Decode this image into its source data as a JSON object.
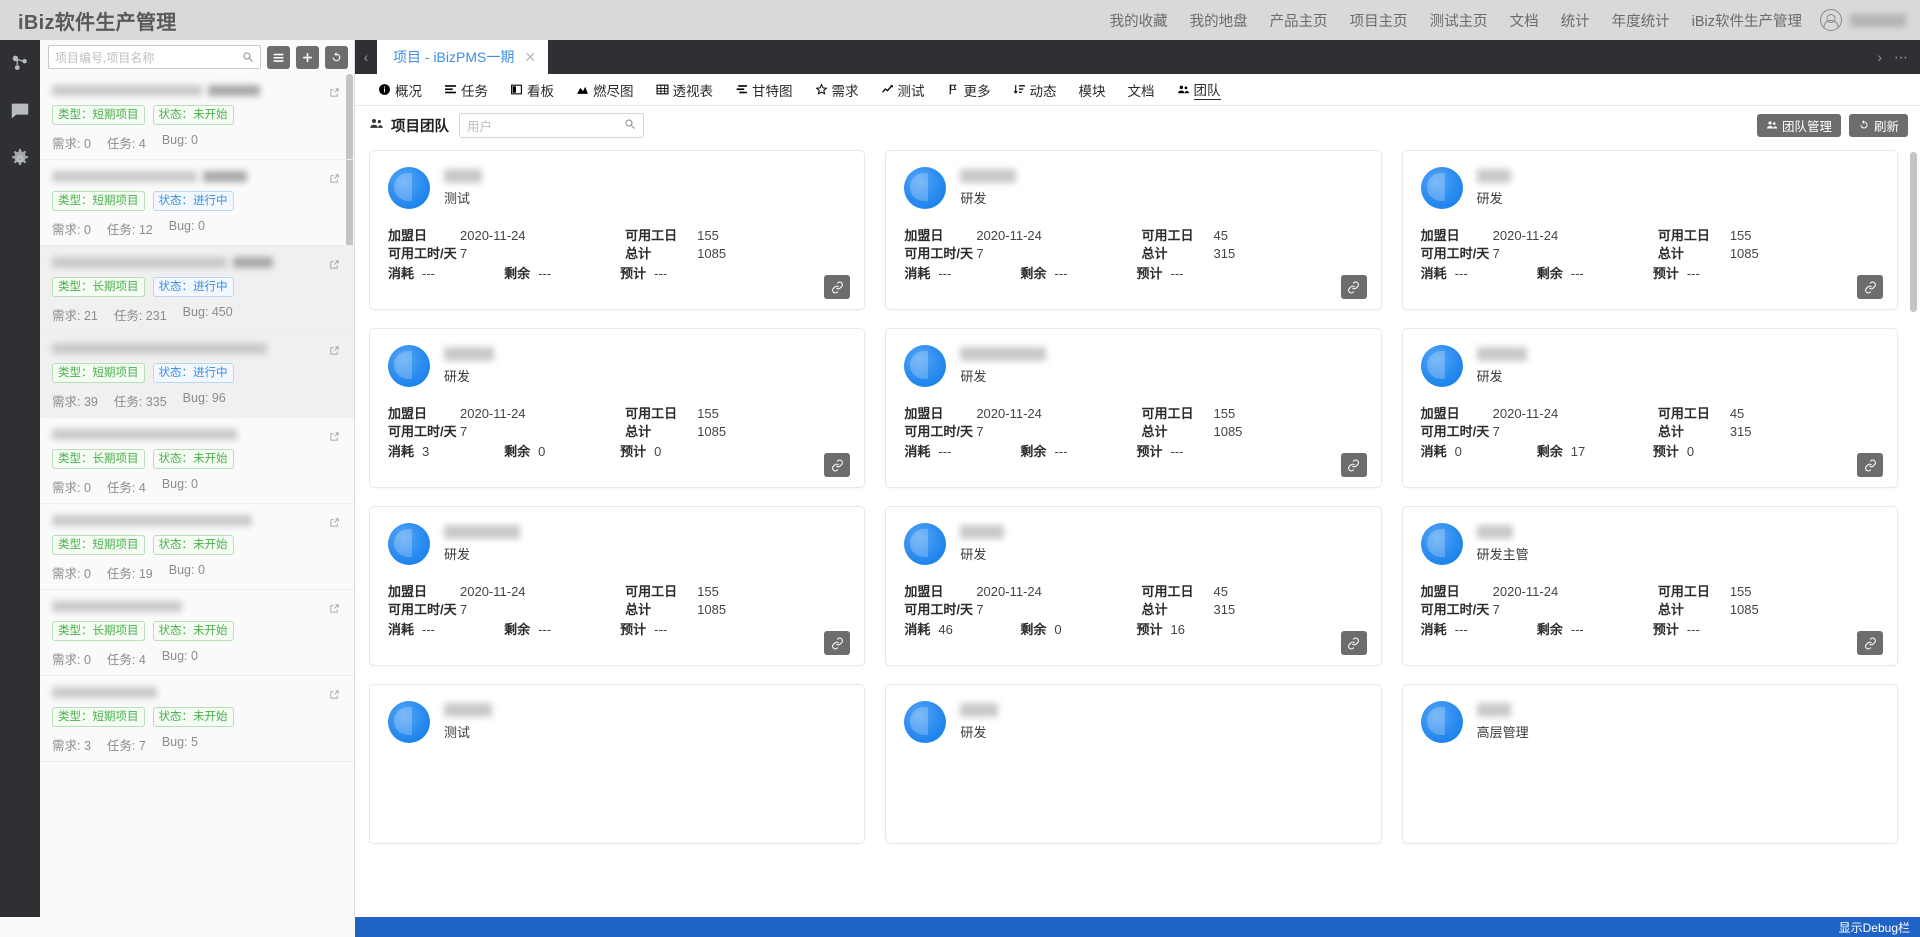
{
  "header": {
    "title": "iBiz软件生产管理",
    "nav": [
      "我的收藏",
      "我的地盘",
      "产品主页",
      "项目主页",
      "测试主页",
      "文档",
      "统计",
      "年度统计",
      "iBiz软件生产管理"
    ],
    "user_avatar_icon": "user-circle-icon"
  },
  "rail": {
    "items": [
      {
        "name": "org-icon",
        "label": "组织"
      },
      {
        "name": "message-icon",
        "label": "消息"
      },
      {
        "name": "gear-icon",
        "label": "设置"
      }
    ]
  },
  "sidebar": {
    "search_placeholder": "项目编号,项目名称",
    "search_icon": "search-icon",
    "buttons": [
      {
        "name": "list-view-button",
        "icon": "list-icon"
      },
      {
        "name": "add-project-button",
        "icon": "plus-icon"
      },
      {
        "name": "refresh-projects-button",
        "icon": "refresh-icon"
      }
    ],
    "items": [
      {
        "type_label": "类型：短期项目",
        "status_label": "状态：未开始",
        "status_kind": "green",
        "stats": [
          "需求: 0",
          "任务: 4",
          "Bug: 0"
        ],
        "selected": false,
        "name_w": 150,
        "tail_w": 52
      },
      {
        "type_label": "类型：短期项目",
        "status_label": "状态：进行中",
        "status_kind": "blue",
        "stats": [
          "需求: 0",
          "任务: 12",
          "Bug: 0"
        ],
        "selected": false,
        "name_w": 145,
        "tail_w": 44
      },
      {
        "type_label": "类型：长期项目",
        "status_label": "状态：进行中",
        "status_kind": "blue",
        "stats": [
          "需求: 21",
          "任务: 231",
          "Bug: 450"
        ],
        "selected": true,
        "name_w": 175,
        "tail_w": 40
      },
      {
        "type_label": "类型：短期项目",
        "status_label": "状态：进行中",
        "status_kind": "blue",
        "stats": [
          "需求: 39",
          "任务: 335",
          "Bug: 96"
        ],
        "selected": true,
        "name_w": 215,
        "tail_w": 0
      },
      {
        "type_label": "类型：长期项目",
        "status_label": "状态：未开始",
        "status_kind": "green",
        "stats": [
          "需求: 0",
          "任务: 4",
          "Bug: 0"
        ],
        "selected": false,
        "name_w": 185,
        "tail_w": 0
      },
      {
        "type_label": "类型：短期项目",
        "status_label": "状态：未开始",
        "status_kind": "green",
        "stats": [
          "需求: 0",
          "任务: 19",
          "Bug: 0"
        ],
        "selected": false,
        "name_w": 200,
        "tail_w": 0
      },
      {
        "type_label": "类型：长期项目",
        "status_label": "状态：未开始",
        "status_kind": "green",
        "stats": [
          "需求: 0",
          "任务: 4",
          "Bug: 0"
        ],
        "selected": false,
        "name_w": 130,
        "tail_w": 0
      },
      {
        "type_label": "类型：短期项目",
        "status_label": "状态：未开始",
        "status_kind": "green",
        "stats": [
          "需求: 3",
          "任务: 7",
          "Bug: 5"
        ],
        "selected": false,
        "name_w": 105,
        "tail_w": 0
      }
    ]
  },
  "tabbar": {
    "back_icon": "chevron-left-icon",
    "tab_label": "项目 - iBizPMS一期",
    "close_icon": "close-icon",
    "next_icon": "chevron-right-icon",
    "more_icon": "ellipsis-icon"
  },
  "subtabs": [
    {
      "label": "概况",
      "icon": "info-icon",
      "active": false
    },
    {
      "label": "任务",
      "icon": "tasks-icon",
      "active": false
    },
    {
      "label": "看板",
      "icon": "board-icon",
      "active": false
    },
    {
      "label": "燃尽图",
      "icon": "burndown-icon",
      "active": false
    },
    {
      "label": "透视表",
      "icon": "table-icon",
      "active": false
    },
    {
      "label": "甘特图",
      "icon": "gantt-icon",
      "active": false
    },
    {
      "label": "需求",
      "icon": "star-icon",
      "active": false
    },
    {
      "label": "测试",
      "icon": "chart-line-icon",
      "active": false
    },
    {
      "label": "更多",
      "icon": "flag-icon",
      "active": false
    },
    {
      "label": "动态",
      "icon": "sort-icon",
      "active": false
    },
    {
      "label": "模块",
      "icon": "",
      "active": false
    },
    {
      "label": "文档",
      "icon": "",
      "active": false
    },
    {
      "label": "团队",
      "icon": "team-icon",
      "active": true
    }
  ],
  "controlbar": {
    "title": "项目团队",
    "title_icon": "team-icon",
    "search_placeholder": "用户",
    "search_icon": "search-icon",
    "buttons": [
      {
        "label": "团队管理",
        "icon": "team-icon",
        "name": "team-manage-button"
      },
      {
        "label": "刷新",
        "icon": "refresh-icon",
        "name": "refresh-button"
      }
    ]
  },
  "card_labels": {
    "join_date": "加盟日",
    "available_days": "可用工日",
    "hours_per_day": "可用工时/天",
    "total": "总计",
    "consumed": "消耗",
    "remaining": "剩余",
    "estimated": "预计",
    "action_icon": "link-icon"
  },
  "cards": [
    {
      "role": "测试",
      "name_w": 38,
      "join_date": "2020-11-24",
      "available_days": "155",
      "hours_per_day": "7",
      "total": "1085",
      "consumed": "---",
      "remaining": "---",
      "estimated": "---"
    },
    {
      "role": "研发",
      "name_w": 56,
      "join_date": "2020-11-24",
      "available_days": "45",
      "hours_per_day": "7",
      "total": "315",
      "consumed": "---",
      "remaining": "---",
      "estimated": "---"
    },
    {
      "role": "研发",
      "name_w": 34,
      "join_date": "2020-11-24",
      "available_days": "155",
      "hours_per_day": "7",
      "total": "1085",
      "consumed": "---",
      "remaining": "---",
      "estimated": "---"
    },
    {
      "role": "研发",
      "name_w": 50,
      "join_date": "2020-11-24",
      "available_days": "155",
      "hours_per_day": "7",
      "total": "1085",
      "consumed": "3",
      "remaining": "0",
      "estimated": "0"
    },
    {
      "role": "研发",
      "name_w": 86,
      "join_date": "2020-11-24",
      "available_days": "155",
      "hours_per_day": "7",
      "total": "1085",
      "consumed": "---",
      "remaining": "---",
      "estimated": "---"
    },
    {
      "role": "研发",
      "name_w": 50,
      "join_date": "2020-11-24",
      "available_days": "45",
      "hours_per_day": "7",
      "total": "315",
      "consumed": "0",
      "remaining": "17",
      "estimated": "0"
    },
    {
      "role": "研发",
      "name_w": 76,
      "join_date": "2020-11-24",
      "available_days": "155",
      "hours_per_day": "7",
      "total": "1085",
      "consumed": "---",
      "remaining": "---",
      "estimated": "---"
    },
    {
      "role": "研发",
      "name_w": 44,
      "join_date": "2020-11-24",
      "available_days": "45",
      "hours_per_day": "7",
      "total": "315",
      "consumed": "46",
      "remaining": "0",
      "estimated": "16"
    },
    {
      "role": "研发主管",
      "name_w": 36,
      "join_date": "2020-11-24",
      "available_days": "155",
      "hours_per_day": "7",
      "total": "1085",
      "consumed": "---",
      "remaining": "---",
      "estimated": "---"
    },
    {
      "role": "测试",
      "name_w": 48,
      "join_date": "",
      "available_days": "",
      "hours_per_day": "",
      "total": "",
      "consumed": "",
      "remaining": "",
      "estimated": ""
    },
    {
      "role": "研发",
      "name_w": 38,
      "join_date": "",
      "available_days": "",
      "hours_per_day": "",
      "total": "",
      "consumed": "",
      "remaining": "",
      "estimated": ""
    },
    {
      "role": "高层管理",
      "name_w": 34,
      "join_date": "",
      "available_days": "",
      "hours_per_day": "",
      "total": "",
      "consumed": "",
      "remaining": "",
      "estimated": ""
    }
  ],
  "footer": {
    "debug_label": "显示Debug栏",
    "accent": "#1f63c4"
  }
}
